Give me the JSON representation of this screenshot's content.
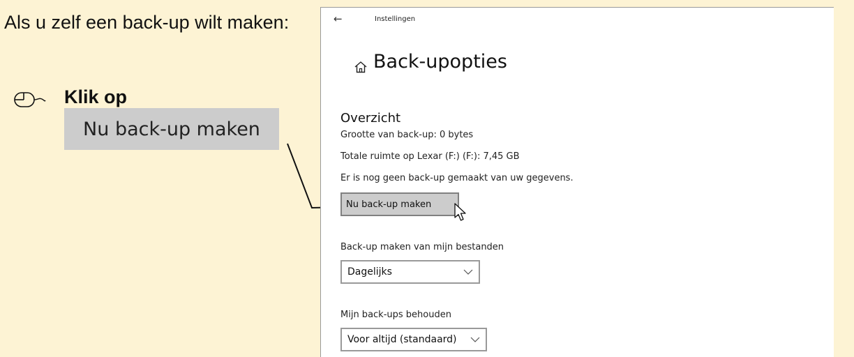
{
  "instruction": {
    "title": "Als u zelf een back-up wilt maken:",
    "step_label": "Klik op",
    "button_illustration_label": "Nu back-up maken"
  },
  "window": {
    "title": "Instellingen",
    "page_title": "Back-upopties",
    "overview": {
      "heading": "Overzicht",
      "backup_size": "Grootte van back-up: 0 bytes",
      "total_space": "Totale ruimte op Lexar (F:) (F:): 7,45 GB",
      "status": "Er is nog geen back-up gemaakt van uw gegevens.",
      "backup_now_button": "Nu back-up maken"
    },
    "backup_frequency": {
      "label": "Back-up maken van mijn bestanden",
      "selected": "Dagelijks"
    },
    "keep_backups": {
      "label": "Mijn back-ups behouden",
      "selected": "Voor altijd (standaard)"
    }
  },
  "icons": {
    "back": "back-arrow-icon",
    "home": "home-icon",
    "mouse": "mouse-icon",
    "cursor": "pointer-cursor-icon",
    "chevron": "chevron-down-icon"
  },
  "colors": {
    "panel_background": "#fdf3d4",
    "button_gray": "#cccccc",
    "window_background": "#ffffff"
  }
}
